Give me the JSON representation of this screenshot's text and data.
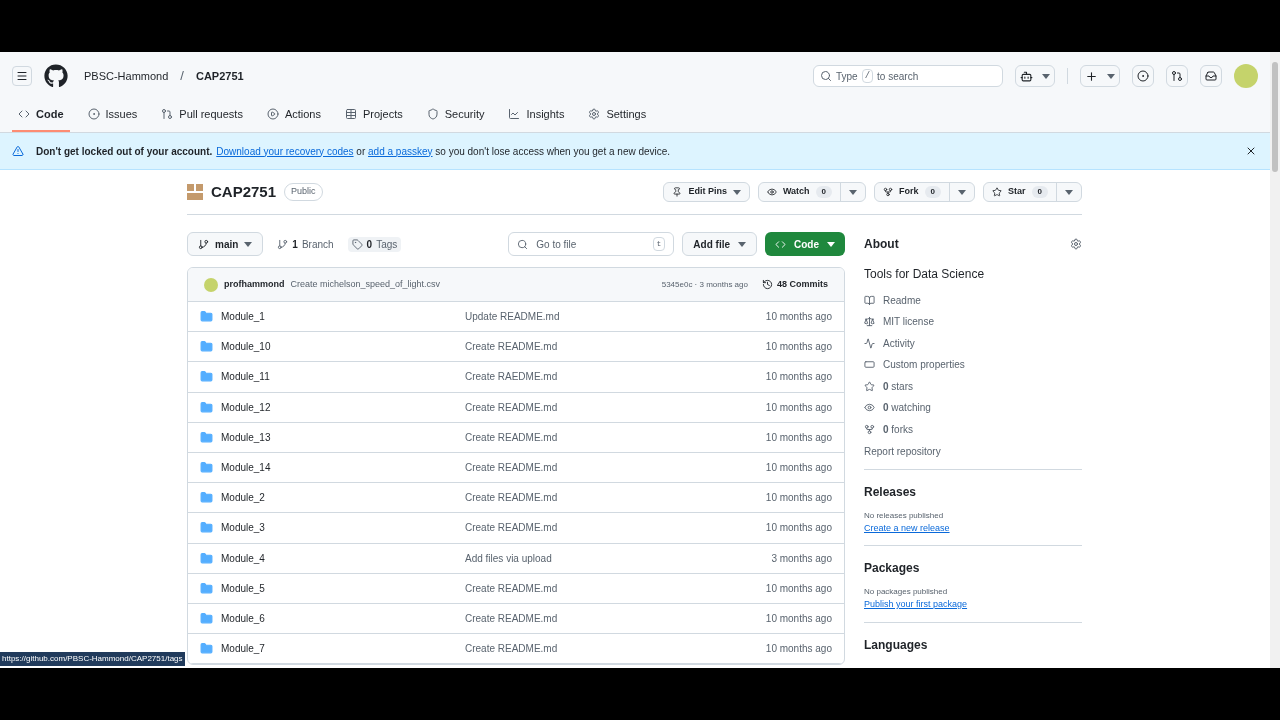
{
  "header": {
    "owner": "PBSC-Hammond",
    "separator": "/",
    "repo": "CAP2751",
    "search": {
      "before": "Type",
      "key": "/",
      "after": "to search"
    }
  },
  "nav_tabs": [
    {
      "label": "Code",
      "kind": "code",
      "selected": true
    },
    {
      "label": "Issues",
      "kind": "issues",
      "selected": false
    },
    {
      "label": "Pull requests",
      "kind": "pulls",
      "selected": false
    },
    {
      "label": "Actions",
      "kind": "actions",
      "selected": false
    },
    {
      "label": "Projects",
      "kind": "projects",
      "selected": false
    },
    {
      "label": "Security",
      "kind": "security",
      "selected": false
    },
    {
      "label": "Insights",
      "kind": "insights",
      "selected": false
    },
    {
      "label": "Settings",
      "kind": "settings",
      "selected": false
    }
  ],
  "banner": {
    "segments": [
      {
        "kind": "bold",
        "text": "Don't get locked out of your account."
      },
      {
        "kind": "link",
        "text": "Download your recovery codes"
      },
      {
        "kind": "text",
        "text": " or "
      },
      {
        "kind": "link",
        "text": "add a passkey"
      },
      {
        "kind": "text",
        "text": " so you don't lose access when you get a new device."
      }
    ]
  },
  "repo": {
    "name": "CAP2751",
    "visibility": "Public",
    "edit_pins": "Edit Pins",
    "watch": {
      "label": "Watch",
      "count": "0"
    },
    "fork": {
      "label": "Fork",
      "count": "0"
    },
    "star": {
      "label": "Star",
      "count": "0"
    }
  },
  "toolbar": {
    "branch": "main",
    "branches": {
      "count": "1",
      "label": "Branch"
    },
    "tags": {
      "count": "0",
      "label": "Tags"
    },
    "go_to_file": {
      "placeholder": "Go to file",
      "key": "t"
    },
    "add_file": "Add file",
    "code": "Code"
  },
  "latest_commit": {
    "author": "profhammond",
    "message": "Create michelson_speed_of_light.csv",
    "hash_time": "5345e0c · 3 months ago",
    "commits": "48 Commits"
  },
  "files": [
    {
      "name": "Module_1",
      "message": "Update README.md",
      "time": "10 months ago"
    },
    {
      "name": "Module_10",
      "message": "Create README.md",
      "time": "10 months ago"
    },
    {
      "name": "Module_11",
      "message": "Create RAEDME.md",
      "time": "10 months ago"
    },
    {
      "name": "Module_12",
      "message": "Create README.md",
      "time": "10 months ago"
    },
    {
      "name": "Module_13",
      "message": "Create README.md",
      "time": "10 months ago"
    },
    {
      "name": "Module_14",
      "message": "Create README.md",
      "time": "10 months ago"
    },
    {
      "name": "Module_2",
      "message": "Create README.md",
      "time": "10 months ago"
    },
    {
      "name": "Module_3",
      "message": "Create README.md",
      "time": "10 months ago"
    },
    {
      "name": "Module_4",
      "message": "Add files via upload",
      "time": "3 months ago"
    },
    {
      "name": "Module_5",
      "message": "Create README.md",
      "time": "10 months ago"
    },
    {
      "name": "Module_6",
      "message": "Create README.md",
      "time": "10 months ago"
    },
    {
      "name": "Module_7",
      "message": "Create README.md",
      "time": "10 months ago"
    }
  ],
  "about": {
    "title": "About",
    "description": "Tools for Data Science",
    "links": [
      {
        "kind": "readme",
        "text": "Readme"
      },
      {
        "kind": "license",
        "text": "MIT license"
      },
      {
        "kind": "activity",
        "text": "Activity"
      },
      {
        "kind": "properties",
        "text": "Custom properties"
      },
      {
        "kind": "stars",
        "text": "**0** stars"
      },
      {
        "kind": "watching",
        "text": "**0** watching"
      },
      {
        "kind": "forks",
        "text": "**0** forks"
      }
    ],
    "report": "Report repository"
  },
  "releases": {
    "title": "Releases",
    "note": "No releases published",
    "link": "Create a new release"
  },
  "packages": {
    "title": "Packages",
    "note": "No packages published",
    "link": "Publish your first package"
  },
  "languages": {
    "title": "Languages"
  },
  "status_url": "https://github.com/PBSC-Hammond/CAP2751/tags"
}
